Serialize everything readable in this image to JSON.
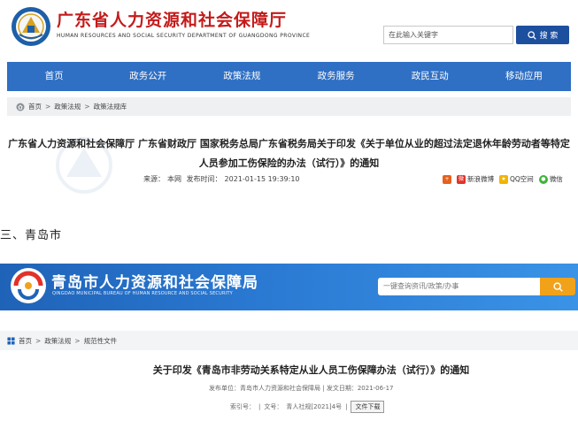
{
  "gd": {
    "title": "广东省人力资源和社会保障厅",
    "subtitle": "HUMAN RESOURCES AND SOCIAL SECURITY DEPARTMENT OF GUANGDONG PROVINCE",
    "search_placeholder": "在此输入关键字",
    "search_label": "搜 索",
    "nav": [
      "首页",
      "政务公开",
      "政策法规",
      "政务服务",
      "政民互动",
      "移动应用"
    ],
    "breadcrumb": [
      "首页",
      "政策法规",
      "政策法规库"
    ],
    "article_title": "广东省人力资源和社会保障厅 广东省财政厅 国家税务总局广东省税务局关于印发《关于单位从业的超过法定退休年龄劳动者等特定人员参加工伤保险的办法（试行）》的通知",
    "meta_source_label": "来源：",
    "meta_source": "本网",
    "meta_time_label": "发布时间：",
    "meta_time": "2021-01-15 19:39:10",
    "share": [
      "新浪微博",
      "QQ空间",
      "微信"
    ]
  },
  "section_heading": "三、青岛市",
  "qd": {
    "title": "青岛市人力资源和社会保障局",
    "subtitle": "QINGDAO MUNICIPAL BUREAU OF HUMAN RESOURCE AND SOCIAL SECURITY",
    "search_placeholder": "一键查询资讯/政策/办事",
    "breadcrumb": [
      "首页",
      "政策法规",
      "规范性文件"
    ],
    "article_title": "关于印发《青岛市非劳动关系特定从业人员工伤保障办法（试行）》的通知",
    "meta_publisher_label": "发布单位：",
    "meta_publisher": "青岛市人力资源和社会保障局",
    "meta_date_label": "发文日期：",
    "meta_date": "2021-06-17",
    "meta_index_label": "索引号：",
    "meta_docno_label": "文号：",
    "meta_docno": "青人社规[2021]4号",
    "download_label": "文件下载"
  },
  "colors": {
    "gd_red": "#c41b1b",
    "gd_nav_blue": "#2f6fc4",
    "qd_banner_blue": "#2a79d2",
    "qd_search_orange": "#f0a21a"
  }
}
